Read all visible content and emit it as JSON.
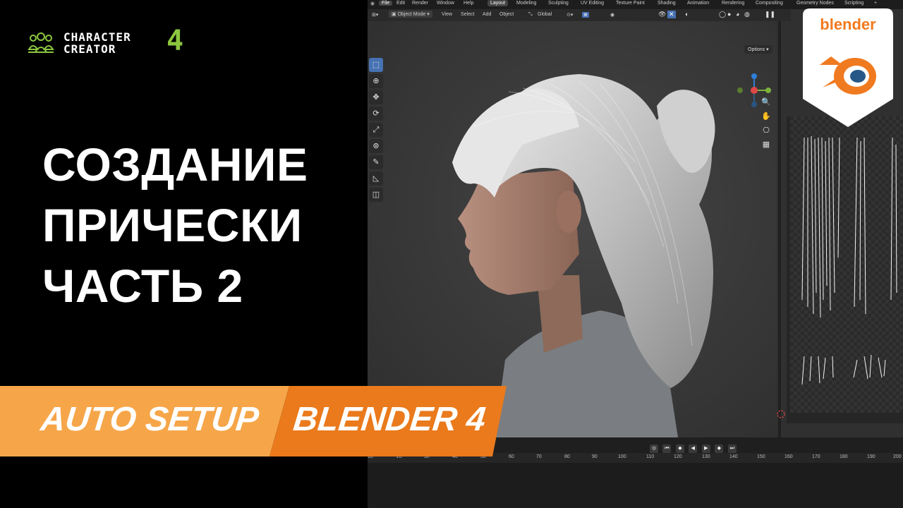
{
  "brand": {
    "line1": "CHARACTER",
    "line2": "CREATOR",
    "version": "4"
  },
  "headline": {
    "line1": "СОЗДАНИЕ",
    "line2": "ПРИЧЕСКИ",
    "line3": "ЧАСТЬ 2"
  },
  "banner": {
    "left": "AUTO SETUP",
    "right": "BLENDER 4",
    "left_color": "#f6a649",
    "right_color": "#ea7a1c"
  },
  "blender_badge": {
    "label": "blender",
    "accent": "#f07a1f",
    "blue": "#265787"
  },
  "menu": {
    "file": "File",
    "edit": "Edit",
    "render": "Render",
    "window": "Window",
    "help": "Help"
  },
  "workspaces": [
    "Layout",
    "Modeling",
    "Sculpting",
    "UV Editing",
    "Texture Paint",
    "Shading",
    "Animation",
    "Rendering",
    "Compositing",
    "Geometry Nodes",
    "Scripting",
    "+"
  ],
  "viewport_header": {
    "mode": "Object Mode",
    "view": "View",
    "select": "Select",
    "add": "Add",
    "object": "Object",
    "orientation": "Global",
    "options": "Options"
  },
  "toolbar_icons": [
    "select-box-icon",
    "cursor-icon",
    "move-icon",
    "rotate-icon",
    "scale-icon",
    "transform-icon",
    "annotate-icon",
    "measure-icon",
    "add-cube-icon"
  ],
  "timeline": {
    "ticks": [
      "10",
      "20",
      "30",
      "40",
      "50",
      "60",
      "70",
      "80",
      "90",
      "100",
      "110",
      "120",
      "130",
      "140",
      "150",
      "160",
      "170",
      "180",
      "190",
      "200"
    ]
  }
}
